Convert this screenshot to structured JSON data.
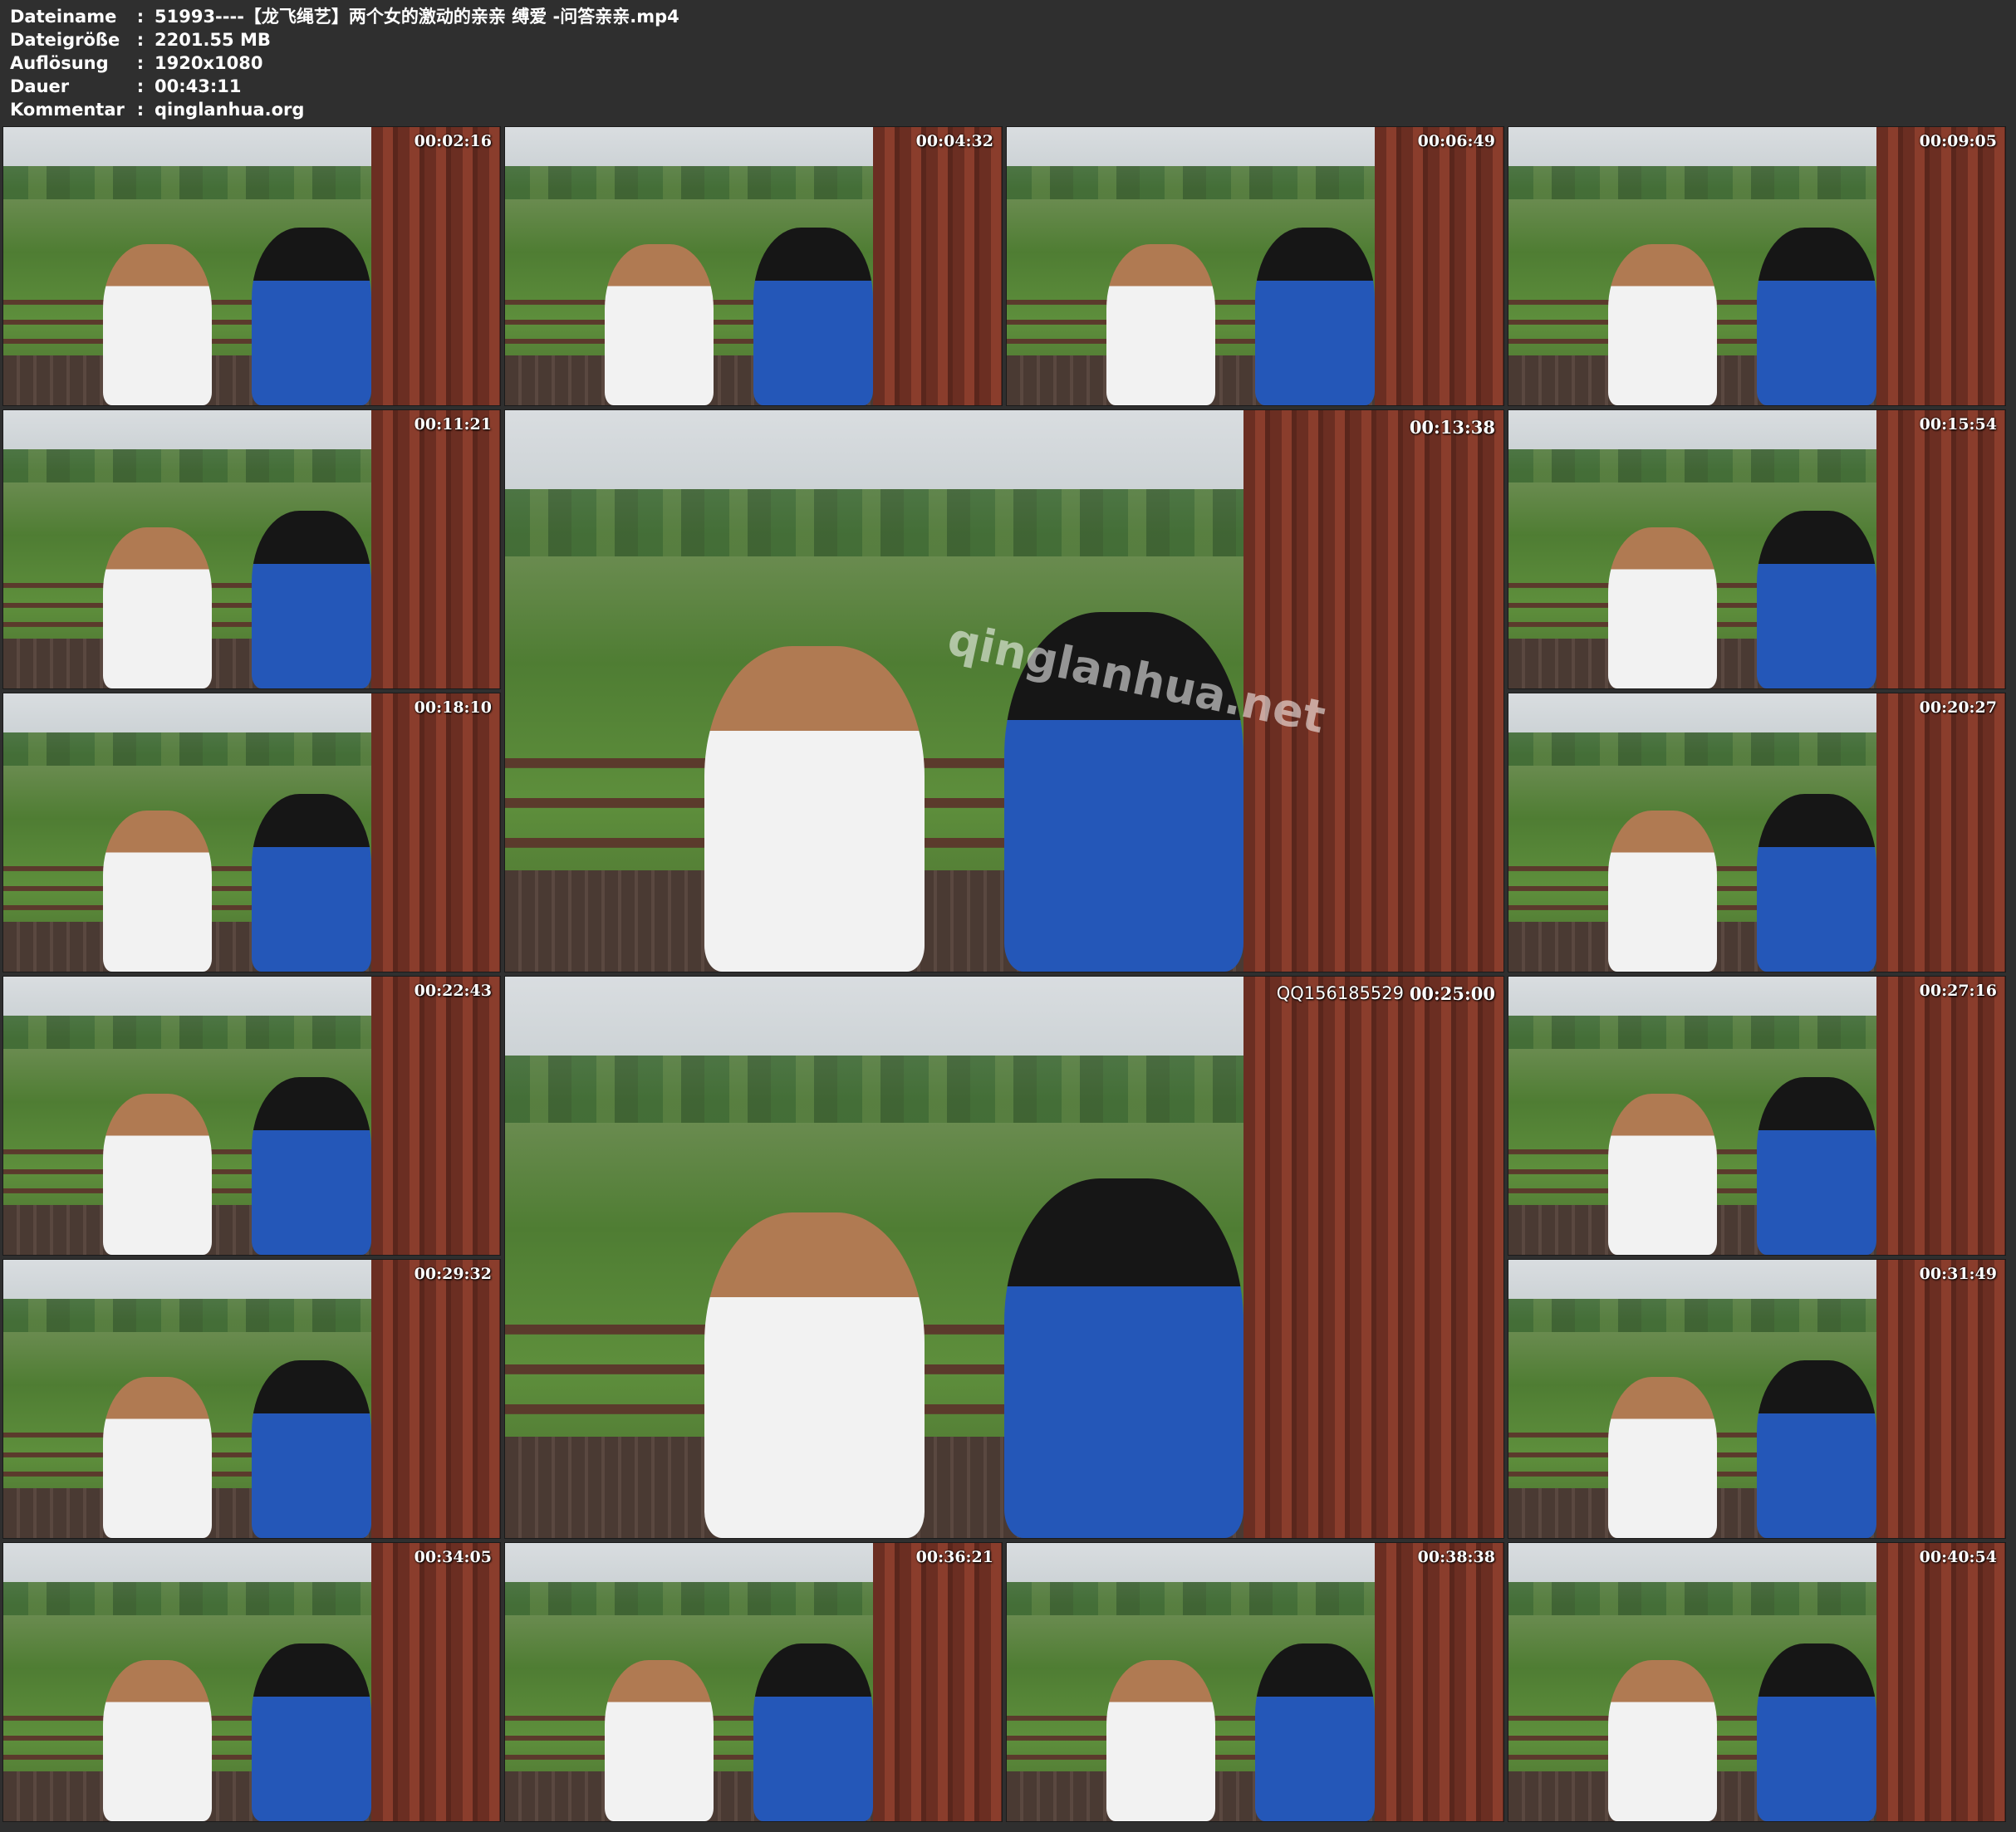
{
  "file_info": [
    {
      "key": "Dateiname",
      "sep": ":",
      "value": "51993----【龙飞绳艺】两个女的激动的亲亲 缚爱 -问答亲亲.mp4"
    },
    {
      "key": "Dateigröße",
      "sep": ":",
      "value": "2201.55 MB"
    },
    {
      "key": "Auflösung",
      "sep": ":",
      "value": "1920x1080"
    },
    {
      "key": "Dauer",
      "sep": ":",
      "value": "00:43:11"
    },
    {
      "key": "Kommentar",
      "sep": ":",
      "value": "qinglanhua.org"
    }
  ],
  "thumbnails": [
    {
      "timestamp": "00:02:16"
    },
    {
      "timestamp": "00:04:32"
    },
    {
      "timestamp": "00:06:49"
    },
    {
      "timestamp": "00:09:05"
    },
    {
      "timestamp": "00:11:21"
    },
    {
      "timestamp": "00:13:38",
      "watermark": "qinglanhua.net"
    },
    {
      "timestamp": "00:15:54"
    },
    {
      "timestamp": "00:18:10"
    },
    {
      "timestamp": "00:20:27"
    },
    {
      "timestamp": "00:22:43"
    },
    {
      "timestamp": "00:25:00",
      "overlay_text": "QQ156185529"
    },
    {
      "timestamp": "00:27:16"
    },
    {
      "timestamp": "00:29:32"
    },
    {
      "timestamp": "00:31:49"
    },
    {
      "timestamp": "00:34:05"
    },
    {
      "timestamp": "00:36:21"
    },
    {
      "timestamp": "00:38:38"
    },
    {
      "timestamp": "00:40:54"
    }
  ],
  "colors": {
    "background": "#2f2f2f",
    "text": "#ffffff"
  }
}
